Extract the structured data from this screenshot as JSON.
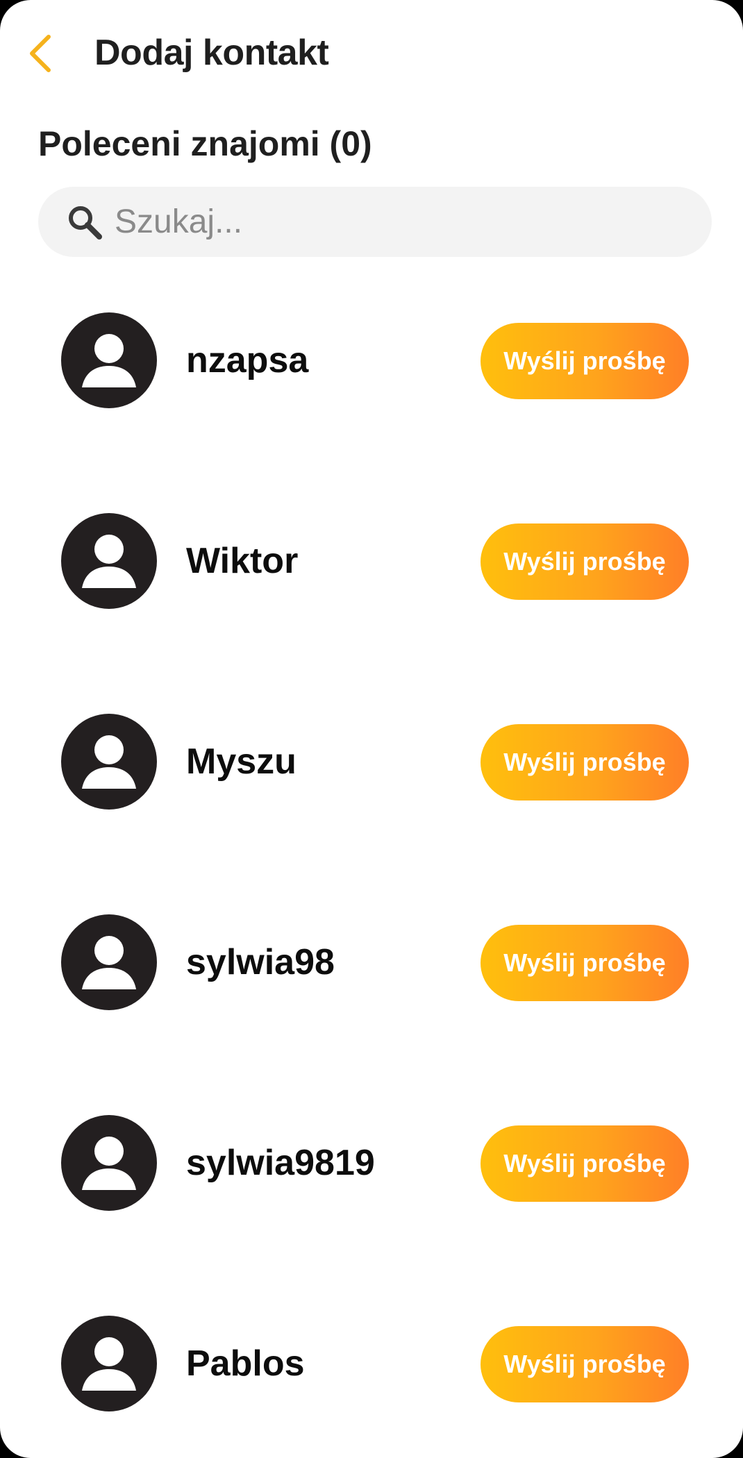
{
  "header": {
    "title": "Dodaj kontakt",
    "back_icon": "chevron-left-icon",
    "accent_color": "#f5b21c"
  },
  "section": {
    "title": "Poleceni znajomi (0)"
  },
  "search": {
    "placeholder": "Szukaj...",
    "value": "",
    "icon": "search-icon"
  },
  "contacts": [
    {
      "name": "nzapsa",
      "button_label": "Wyślij prośbę"
    },
    {
      "name": "Wiktor",
      "button_label": "Wyślij prośbę"
    },
    {
      "name": "Myszu",
      "button_label": "Wyślij prośbę"
    },
    {
      "name": "sylwia98",
      "button_label": "Wyślij prośbę"
    },
    {
      "name": "sylwia9819",
      "button_label": "Wyślij prośbę"
    },
    {
      "name": "Pablos",
      "button_label": "Wyślij prośbę"
    }
  ],
  "colors": {
    "button_gradient_start": "#ffbf0d",
    "button_gradient_end": "#ff7f27",
    "avatar_background": "#231f20"
  }
}
